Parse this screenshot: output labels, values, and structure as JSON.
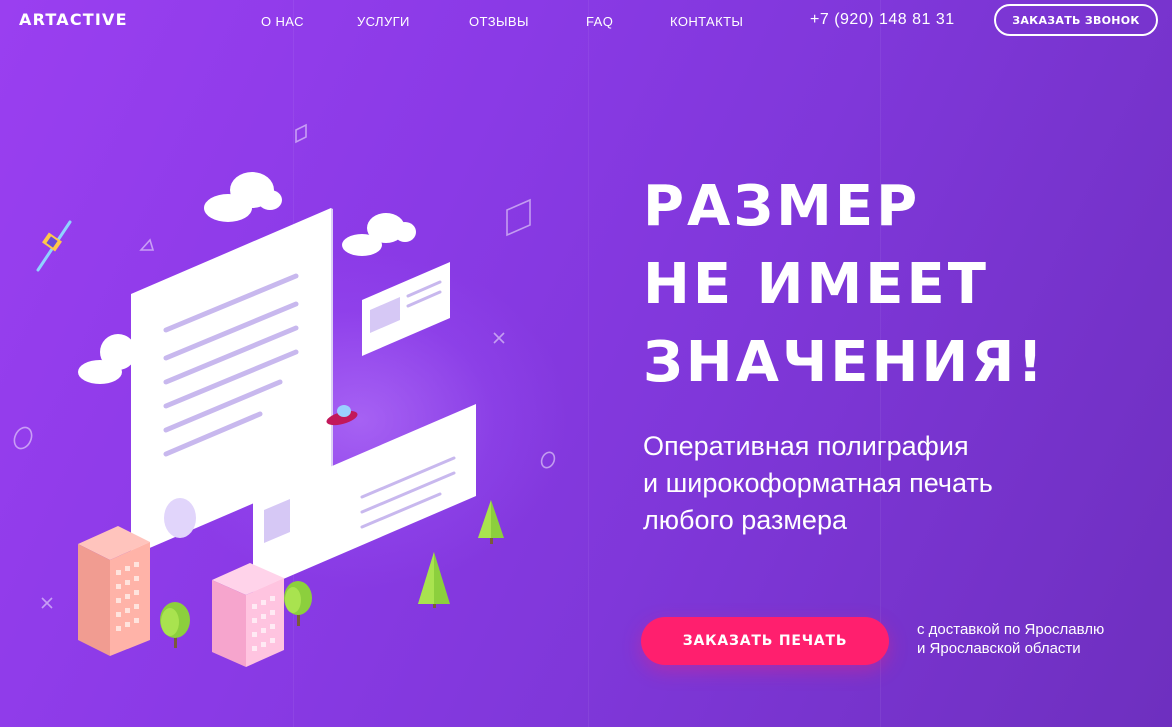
{
  "header": {
    "logo": "ARTACTIVE",
    "nav": [
      {
        "label": "О НАС"
      },
      {
        "label": "УСЛУГИ"
      },
      {
        "label": "ОТЗЫВЫ"
      },
      {
        "label": "FAQ"
      },
      {
        "label": "КОНТАКТЫ"
      }
    ],
    "phone": "+7 (920) 148 81 31",
    "call_button": "ЗАКАЗАТЬ ЗВОНОК"
  },
  "hero": {
    "headline": [
      "РАЗМЕР",
      "НЕ ИМЕЕТ",
      "ЗНАЧЕНИЯ!"
    ],
    "subtitle": [
      "Оперативная полиграфия",
      "и широкоформатная печать",
      "любого размера"
    ],
    "cta_button": "ЗАКАЗАТЬ ПЕЧАТЬ",
    "delivery_note": [
      "с доставкой по Ярославлю",
      "и Ярославской области"
    ]
  },
  "illustration": {
    "icons": [
      "cloud-icon",
      "satellite-icon",
      "ufo-icon",
      "tree-icon",
      "building-icon",
      "document-icon",
      "card-icon"
    ]
  },
  "colors": {
    "background_start": "#9a3ff0",
    "background_end": "#6e2fbf",
    "cta": "#ff1f6e",
    "text": "#ffffff"
  }
}
